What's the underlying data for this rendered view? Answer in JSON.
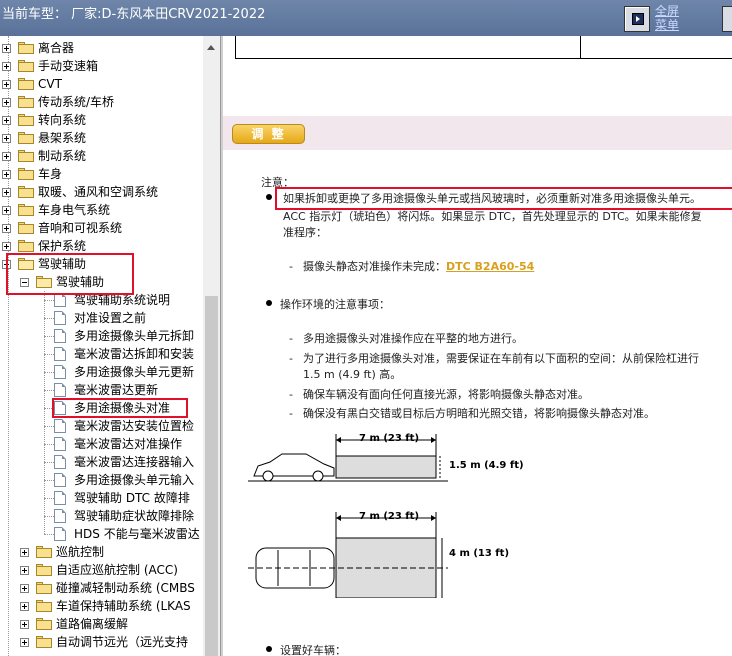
{
  "header": {
    "title": "当前车型：  厂家:D-东风本田CRV2021-2022",
    "full_link_line1": "全屏",
    "full_link_line2": "菜单"
  },
  "tree": {
    "top_items": [
      "离合器",
      "手动变速箱",
      "CVT",
      "传动系统/车桥",
      "转向系统",
      "悬架系统",
      "制动系统",
      "车身",
      "取暖、通风和空调系统",
      "车身电气系统",
      "音响和可视系统",
      "保护系统"
    ],
    "open_folder": "驾驶辅助",
    "open_subfolder": "驾驶辅助",
    "docs": [
      "驾驶辅助系统说明",
      "对准设置之前",
      "多用途摄像头单元拆卸",
      "毫米波雷达拆卸和安装",
      "多用途摄像头单元更新",
      "毫米波雷达更新",
      "多用途摄像头对准",
      "毫米波雷达安装位置检",
      "毫米波雷达对准操作",
      "毫米波雷达连接器输入",
      "多用途摄像头单元输入",
      "驾驶辅助 DTC 故障排",
      "驾驶辅助症状故障排除",
      "HDS 不能与毫米波雷达"
    ],
    "bottom_items": [
      "巡航控制",
      "自适应巡航控制 (ACC)",
      "碰撞减轻制动系统 (CMBS",
      "车道保持辅助系统 (LKAS",
      "道路偏离缓解",
      "自动调节远光（远光支持"
    ]
  },
  "content": {
    "section_button": "调 整",
    "note_label": "注意：",
    "note_line1": "如果拆卸或更换了多用途摄像头单元或挡风玻璃时，必须重新对准多用途摄像头单元。",
    "note_line2": "ACC 指示灯（琥珀色）将闪烁。如果显示 DTC，首先处理显示的 DTC。如果未能修复",
    "note_line3": "准程序：",
    "dtc_prefix": "摄像头静态对准操作未完成：",
    "dtc_code": "DTC B2A60-54",
    "env_title": "操作环境的注意事项：",
    "env_items": [
      "多用途摄像头对准操作应在平整的地方进行。",
      "为了进行多用途摄像头对准，需要保证在车前有以下面积的空间：从前保险杠进行",
      "1.5 m (4.9 ft) 高。",
      "确保车辆没有面向任何直接光源，将影响摄像头静态对准。",
      "确保没有黑白交错或目标后方明暗和光照交错，将影响摄像头静态对准。"
    ],
    "diagram": {
      "side_width": "7 m (23 ft)",
      "side_height": "1.5 m (4.9 ft)",
      "top_width": "7 m (23 ft)",
      "top_depth": "4 m (13 ft)"
    },
    "last_bullet": "设置好车辆："
  }
}
